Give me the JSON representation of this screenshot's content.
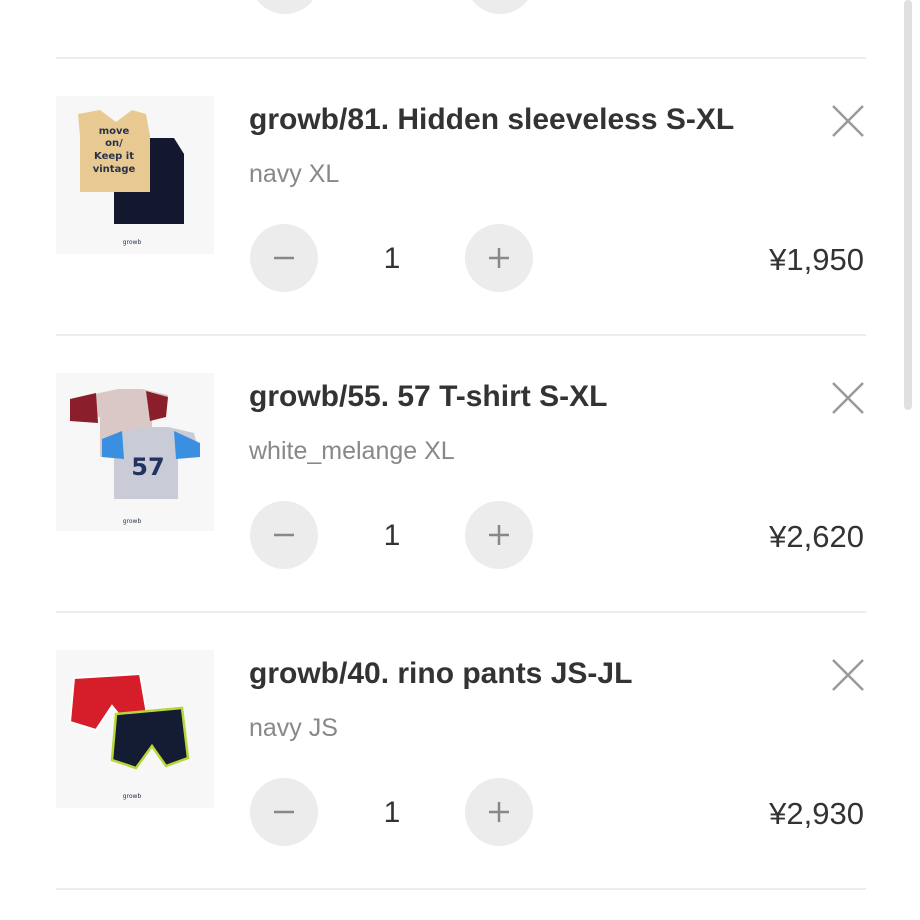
{
  "cart": {
    "items": [
      {
        "name": "growb/81. Hidden sleeveless S-XL",
        "variant": "navy XL",
        "quantity": "1",
        "price": "¥1,950",
        "image_text": "move on/ Keep it vintage",
        "image_brand": "growb"
      },
      {
        "name": "growb/55. 57 T-shirt S-XL",
        "variant": "white_melange XL",
        "quantity": "1",
        "price": "¥2,620",
        "image_text": "57",
        "image_brand": "growb"
      },
      {
        "name": "growb/40. rino pants JS-JL",
        "variant": "navy JS",
        "quantity": "1",
        "price": "¥2,930",
        "image_text": "",
        "image_brand": "growb"
      }
    ],
    "icons": {
      "remove": "close-icon",
      "decrease": "minus-icon",
      "increase": "plus-icon"
    },
    "colors": {
      "button_bg": "#ececec",
      "text_primary": "#333333",
      "text_secondary": "#888888",
      "divider": "#ececec"
    }
  }
}
